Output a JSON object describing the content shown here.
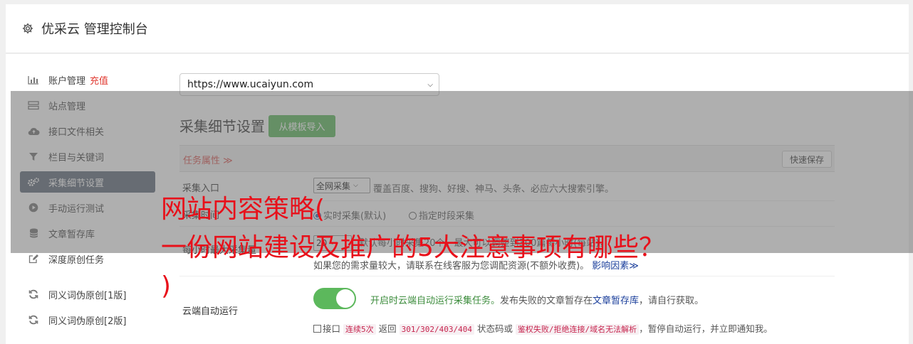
{
  "header": {
    "title": "优采云 管理控制台"
  },
  "sidebar": {
    "items": [
      {
        "label": "账户管理",
        "badge": "充值",
        "icon": "bar-chart-icon"
      },
      {
        "label": "站点管理",
        "icon": "server-icon"
      },
      {
        "label": "接口文件相关",
        "icon": "cloud-upload-icon"
      },
      {
        "label": "栏目与关键词",
        "icon": "filter-icon"
      },
      {
        "label": "采集细节设置",
        "icon": "gears-icon",
        "active": true
      },
      {
        "label": "手动运行测试",
        "icon": "play-circle-icon"
      },
      {
        "label": "文章暂存库",
        "icon": "database-icon"
      },
      {
        "label": "深度原创任务",
        "icon": "edit-icon"
      },
      {
        "label": "同义词伪原创[1版]",
        "icon": "refresh-icon"
      },
      {
        "label": "同义词伪原创[2版]",
        "icon": "refresh-icon"
      }
    ]
  },
  "site_select": {
    "value": "https://www.ucaiyun.com"
  },
  "section": {
    "title": "采集细节设置",
    "template_button": "从模板导入"
  },
  "task_attr": {
    "label": "任务属性 ≫",
    "quick_save": "快速保存"
  },
  "entry": {
    "label": "采集入口",
    "select_value": "全网采集",
    "desc": "覆盖百度、搜狗、好搜、神马、头条、必应六大搜索引擎。"
  },
  "mode": {
    "label": "采集时间",
    "option1": "实时采集(默认)",
    "option2": "指定时段采集"
  },
  "limit": {
    "label": "每小时最大采集量",
    "select_value": "20",
    "desc_line1": "默认每小时采集20个，最大可以调整到300篇每小时(每站)，",
    "desc_line2": "如果您的需求量较大，请联系在线客服为您调配资源(不额外收费)。",
    "link": "影响因素≫"
  },
  "cloud": {
    "label": "云端自动运行",
    "on_text": "开启时云端自动运行采集任务。",
    "desc_pre": "发布失败的文章暂存在",
    "link": "文章暂存库",
    "desc_post": "，请自行获取。",
    "cb_text": "接口",
    "code1": "连续5次",
    "mid1": "返回",
    "code2": "301/302/403/404",
    "mid2": "状态码或",
    "code3": "鉴权失败/拒绝连接/域名无法解析",
    "tail": "，暂停自动运行，并立即通知我。"
  },
  "headline": {
    "line1": "网站内容策略(",
    "line2": "一份网站建设及推广的5大注意事项有哪些？",
    "line3": ")"
  },
  "colors": {
    "accent_green": "#5cb85c",
    "sidebar_active": "#5f6b7a",
    "headline_red": "#e8101a"
  }
}
